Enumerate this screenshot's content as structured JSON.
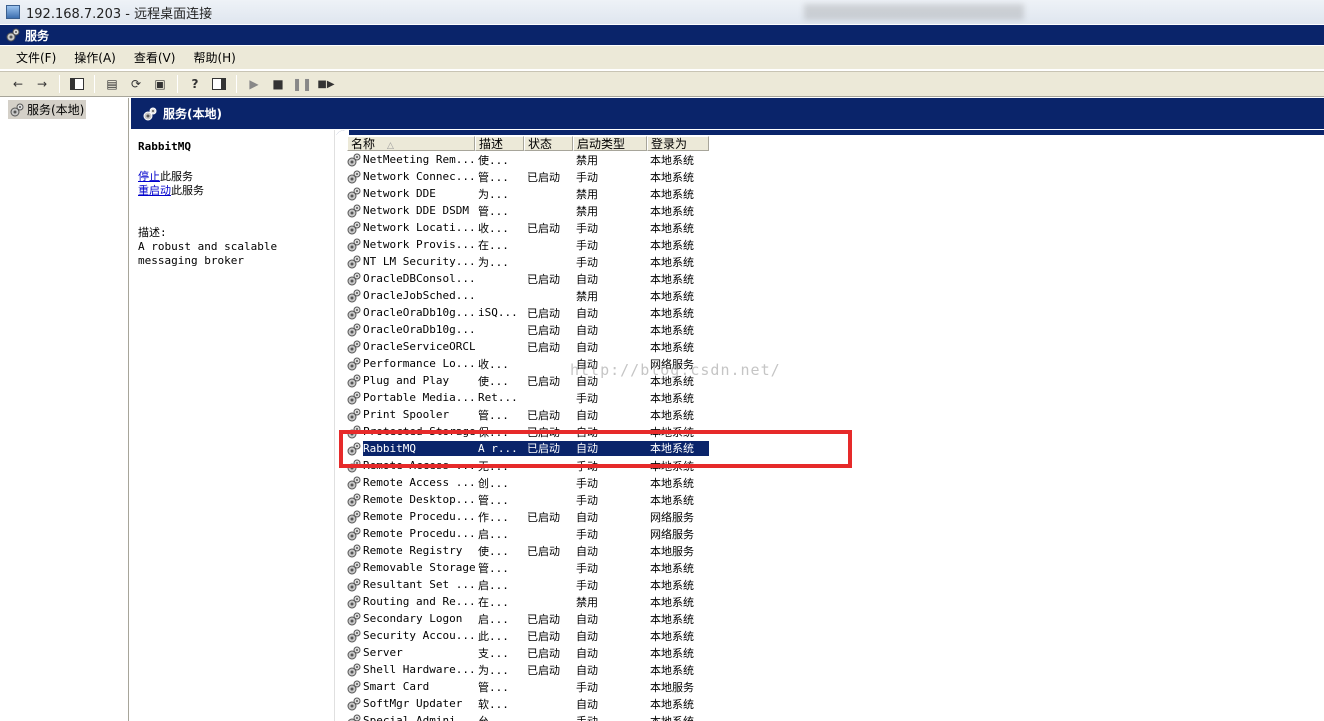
{
  "window": {
    "rdp_title": "192.168.7.203 - 远程桌面连接",
    "mmc_title": "服务"
  },
  "menu": [
    "文件(F)",
    "操作(A)",
    "查看(V)",
    "帮助(H)"
  ],
  "toolbar": {
    "icons": [
      "back-arrow-icon",
      "forward-arrow-icon",
      "show-hide-tree-icon",
      "properties-icon",
      "refresh-icon",
      "export-list-icon",
      "help-icon",
      "show-hide-action-pane-icon",
      "start-service-icon",
      "stop-service-icon",
      "pause-service-icon",
      "restart-service-icon"
    ]
  },
  "tree": {
    "root": "服务(本地)"
  },
  "pane": {
    "title": "服务(本地)",
    "selected_service": "RabbitMQ",
    "stop_link": "停止",
    "stop_suffix": "此服务",
    "restart_link": "重启动",
    "restart_suffix": "此服务",
    "desc_label": "描述:",
    "desc_text": "A robust and scalable messaging broker"
  },
  "columns": [
    "名称",
    "描述",
    "状态",
    "启动类型",
    "登录为"
  ],
  "rows": [
    {
      "name": "NetMeeting Rem...",
      "desc": "使...",
      "status": "",
      "startup": "禁用",
      "logon": "本地系统"
    },
    {
      "name": "Network Connec...",
      "desc": "管...",
      "status": "已启动",
      "startup": "手动",
      "logon": "本地系统"
    },
    {
      "name": "Network DDE",
      "desc": "为...",
      "status": "",
      "startup": "禁用",
      "logon": "本地系统"
    },
    {
      "name": "Network DDE DSDM",
      "desc": "管...",
      "status": "",
      "startup": "禁用",
      "logon": "本地系统"
    },
    {
      "name": "Network Locati...",
      "desc": "收...",
      "status": "已启动",
      "startup": "手动",
      "logon": "本地系统"
    },
    {
      "name": "Network Provis...",
      "desc": "在...",
      "status": "",
      "startup": "手动",
      "logon": "本地系统"
    },
    {
      "name": "NT LM Security...",
      "desc": "为...",
      "status": "",
      "startup": "手动",
      "logon": "本地系统"
    },
    {
      "name": "OracleDBConsol...",
      "desc": "",
      "status": "已启动",
      "startup": "自动",
      "logon": "本地系统"
    },
    {
      "name": "OracleJobSched...",
      "desc": "",
      "status": "",
      "startup": "禁用",
      "logon": "本地系统"
    },
    {
      "name": "OracleOraDb10g...",
      "desc": "iSQ...",
      "status": "已启动",
      "startup": "自动",
      "logon": "本地系统"
    },
    {
      "name": "OracleOraDb10g...",
      "desc": "",
      "status": "已启动",
      "startup": "自动",
      "logon": "本地系统"
    },
    {
      "name": "OracleServiceORCL",
      "desc": "",
      "status": "已启动",
      "startup": "自动",
      "logon": "本地系统"
    },
    {
      "name": "Performance Lo...",
      "desc": "收...",
      "status": "",
      "startup": "自动",
      "logon": "网络服务"
    },
    {
      "name": "Plug and Play",
      "desc": "使...",
      "status": "已启动",
      "startup": "自动",
      "logon": "本地系统"
    },
    {
      "name": "Portable Media...",
      "desc": "Ret...",
      "status": "",
      "startup": "手动",
      "logon": "本地系统"
    },
    {
      "name": "Print Spooler",
      "desc": "管...",
      "status": "已启动",
      "startup": "自动",
      "logon": "本地系统"
    },
    {
      "name": "Protected Storage",
      "desc": "保...",
      "status": "已启动",
      "startup": "自动",
      "logon": "本地系统"
    },
    {
      "name": "RabbitMQ",
      "desc": "A r...",
      "status": "已启动",
      "startup": "自动",
      "logon": "本地系统",
      "selected": true
    },
    {
      "name": "Remote Access ...",
      "desc": "无...",
      "status": "",
      "startup": "手动",
      "logon": "本地系统"
    },
    {
      "name": "Remote Access ...",
      "desc": "创...",
      "status": "",
      "startup": "手动",
      "logon": "本地系统"
    },
    {
      "name": "Remote Desktop...",
      "desc": "管...",
      "status": "",
      "startup": "手动",
      "logon": "本地系统"
    },
    {
      "name": "Remote Procedu...",
      "desc": "作...",
      "status": "已启动",
      "startup": "自动",
      "logon": "网络服务"
    },
    {
      "name": "Remote Procedu...",
      "desc": "启...",
      "status": "",
      "startup": "手动",
      "logon": "网络服务"
    },
    {
      "name": "Remote Registry",
      "desc": "使...",
      "status": "已启动",
      "startup": "自动",
      "logon": "本地服务"
    },
    {
      "name": "Removable Storage",
      "desc": "管...",
      "status": "",
      "startup": "手动",
      "logon": "本地系统"
    },
    {
      "name": "Resultant Set ...",
      "desc": "启...",
      "status": "",
      "startup": "手动",
      "logon": "本地系统"
    },
    {
      "name": "Routing and Re...",
      "desc": "在...",
      "status": "",
      "startup": "禁用",
      "logon": "本地系统"
    },
    {
      "name": "Secondary Logon",
      "desc": "启...",
      "status": "已启动",
      "startup": "自动",
      "logon": "本地系统"
    },
    {
      "name": "Security Accou...",
      "desc": "此...",
      "status": "已启动",
      "startup": "自动",
      "logon": "本地系统"
    },
    {
      "name": "Server",
      "desc": "支...",
      "status": "已启动",
      "startup": "自动",
      "logon": "本地系统"
    },
    {
      "name": "Shell Hardware...",
      "desc": "为...",
      "status": "已启动",
      "startup": "自动",
      "logon": "本地系统"
    },
    {
      "name": "Smart Card",
      "desc": "管...",
      "status": "",
      "startup": "手动",
      "logon": "本地服务"
    },
    {
      "name": "SoftMgr Updater",
      "desc": "软...",
      "status": "",
      "startup": "自动",
      "logon": "本地系统"
    },
    {
      "name": "Special Admini...",
      "desc": "允...",
      "status": "",
      "startup": "手动",
      "logon": "本地系统"
    }
  ],
  "watermark": "http://blog.csdn.net/",
  "colors": {
    "title_bar": "#0a246a",
    "selection": "#0a246a",
    "annotation": "#e62a2a",
    "chrome": "#ece9d8"
  }
}
